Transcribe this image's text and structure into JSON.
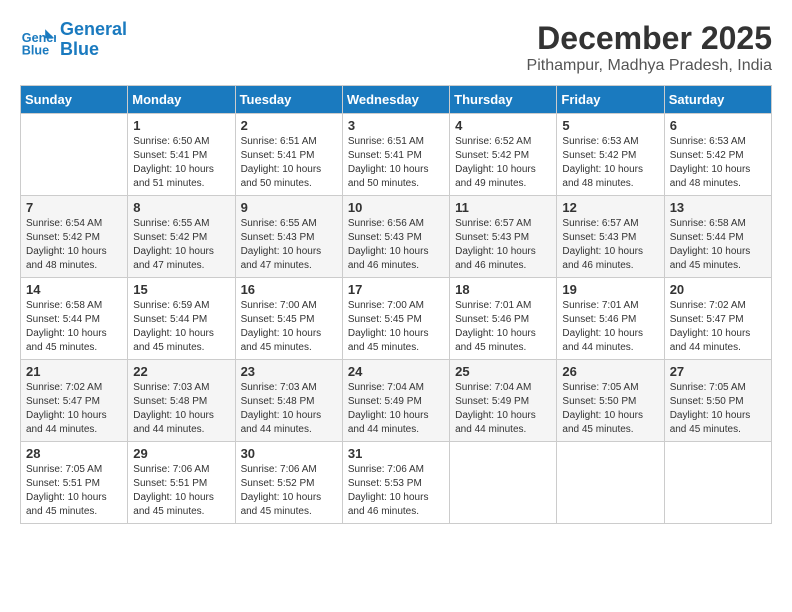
{
  "logo": {
    "line1": "General",
    "line2": "Blue"
  },
  "title": "December 2025",
  "location": "Pithampur, Madhya Pradesh, India",
  "headers": [
    "Sunday",
    "Monday",
    "Tuesday",
    "Wednesday",
    "Thursday",
    "Friday",
    "Saturday"
  ],
  "weeks": [
    [
      {
        "day": "",
        "info": ""
      },
      {
        "day": "1",
        "info": "Sunrise: 6:50 AM\nSunset: 5:41 PM\nDaylight: 10 hours\nand 51 minutes."
      },
      {
        "day": "2",
        "info": "Sunrise: 6:51 AM\nSunset: 5:41 PM\nDaylight: 10 hours\nand 50 minutes."
      },
      {
        "day": "3",
        "info": "Sunrise: 6:51 AM\nSunset: 5:41 PM\nDaylight: 10 hours\nand 50 minutes."
      },
      {
        "day": "4",
        "info": "Sunrise: 6:52 AM\nSunset: 5:42 PM\nDaylight: 10 hours\nand 49 minutes."
      },
      {
        "day": "5",
        "info": "Sunrise: 6:53 AM\nSunset: 5:42 PM\nDaylight: 10 hours\nand 48 minutes."
      },
      {
        "day": "6",
        "info": "Sunrise: 6:53 AM\nSunset: 5:42 PM\nDaylight: 10 hours\nand 48 minutes."
      }
    ],
    [
      {
        "day": "7",
        "info": "Sunrise: 6:54 AM\nSunset: 5:42 PM\nDaylight: 10 hours\nand 48 minutes."
      },
      {
        "day": "8",
        "info": "Sunrise: 6:55 AM\nSunset: 5:42 PM\nDaylight: 10 hours\nand 47 minutes."
      },
      {
        "day": "9",
        "info": "Sunrise: 6:55 AM\nSunset: 5:43 PM\nDaylight: 10 hours\nand 47 minutes."
      },
      {
        "day": "10",
        "info": "Sunrise: 6:56 AM\nSunset: 5:43 PM\nDaylight: 10 hours\nand 46 minutes."
      },
      {
        "day": "11",
        "info": "Sunrise: 6:57 AM\nSunset: 5:43 PM\nDaylight: 10 hours\nand 46 minutes."
      },
      {
        "day": "12",
        "info": "Sunrise: 6:57 AM\nSunset: 5:43 PM\nDaylight: 10 hours\nand 46 minutes."
      },
      {
        "day": "13",
        "info": "Sunrise: 6:58 AM\nSunset: 5:44 PM\nDaylight: 10 hours\nand 45 minutes."
      }
    ],
    [
      {
        "day": "14",
        "info": "Sunrise: 6:58 AM\nSunset: 5:44 PM\nDaylight: 10 hours\nand 45 minutes."
      },
      {
        "day": "15",
        "info": "Sunrise: 6:59 AM\nSunset: 5:44 PM\nDaylight: 10 hours\nand 45 minutes."
      },
      {
        "day": "16",
        "info": "Sunrise: 7:00 AM\nSunset: 5:45 PM\nDaylight: 10 hours\nand 45 minutes."
      },
      {
        "day": "17",
        "info": "Sunrise: 7:00 AM\nSunset: 5:45 PM\nDaylight: 10 hours\nand 45 minutes."
      },
      {
        "day": "18",
        "info": "Sunrise: 7:01 AM\nSunset: 5:46 PM\nDaylight: 10 hours\nand 45 minutes."
      },
      {
        "day": "19",
        "info": "Sunrise: 7:01 AM\nSunset: 5:46 PM\nDaylight: 10 hours\nand 44 minutes."
      },
      {
        "day": "20",
        "info": "Sunrise: 7:02 AM\nSunset: 5:47 PM\nDaylight: 10 hours\nand 44 minutes."
      }
    ],
    [
      {
        "day": "21",
        "info": "Sunrise: 7:02 AM\nSunset: 5:47 PM\nDaylight: 10 hours\nand 44 minutes."
      },
      {
        "day": "22",
        "info": "Sunrise: 7:03 AM\nSunset: 5:48 PM\nDaylight: 10 hours\nand 44 minutes."
      },
      {
        "day": "23",
        "info": "Sunrise: 7:03 AM\nSunset: 5:48 PM\nDaylight: 10 hours\nand 44 minutes."
      },
      {
        "day": "24",
        "info": "Sunrise: 7:04 AM\nSunset: 5:49 PM\nDaylight: 10 hours\nand 44 minutes."
      },
      {
        "day": "25",
        "info": "Sunrise: 7:04 AM\nSunset: 5:49 PM\nDaylight: 10 hours\nand 44 minutes."
      },
      {
        "day": "26",
        "info": "Sunrise: 7:05 AM\nSunset: 5:50 PM\nDaylight: 10 hours\nand 45 minutes."
      },
      {
        "day": "27",
        "info": "Sunrise: 7:05 AM\nSunset: 5:50 PM\nDaylight: 10 hours\nand 45 minutes."
      }
    ],
    [
      {
        "day": "28",
        "info": "Sunrise: 7:05 AM\nSunset: 5:51 PM\nDaylight: 10 hours\nand 45 minutes."
      },
      {
        "day": "29",
        "info": "Sunrise: 7:06 AM\nSunset: 5:51 PM\nDaylight: 10 hours\nand 45 minutes."
      },
      {
        "day": "30",
        "info": "Sunrise: 7:06 AM\nSunset: 5:52 PM\nDaylight: 10 hours\nand 45 minutes."
      },
      {
        "day": "31",
        "info": "Sunrise: 7:06 AM\nSunset: 5:53 PM\nDaylight: 10 hours\nand 46 minutes."
      },
      {
        "day": "",
        "info": ""
      },
      {
        "day": "",
        "info": ""
      },
      {
        "day": "",
        "info": ""
      }
    ]
  ]
}
